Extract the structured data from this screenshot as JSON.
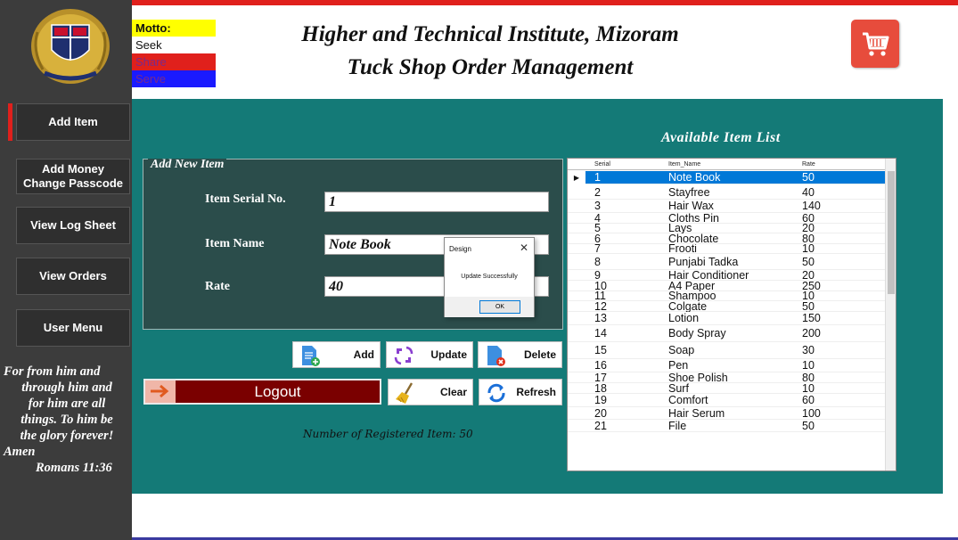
{
  "motto": {
    "heading": "Motto:",
    "words": [
      {
        "text": "Seek",
        "bg": "#ffffff",
        "fg": "#111111"
      },
      {
        "text": "Share",
        "bg": "#e0201c",
        "fg": "#7a2a8a"
      },
      {
        "text": "Serve",
        "bg": "#1a1aff",
        "fg": "#7a2a8a"
      }
    ],
    "heading_bg": "#ffff00"
  },
  "header": {
    "title": "Higher and Technical Institute, Mizoram",
    "subtitle": "Tuck Shop Order Management",
    "cart_icon": "shopping-cart-icon"
  },
  "sidebar": {
    "items": [
      {
        "label": "Add Item",
        "active": true
      },
      {
        "label": "Add Money\nChange Passcode"
      },
      {
        "label": "View Log Sheet"
      },
      {
        "label": "View Orders"
      },
      {
        "label": "User Menu"
      }
    ],
    "quote": [
      "For from him and",
      "through him and",
      "for him are all",
      "things. To him be",
      "the glory forever!",
      "Amen"
    ],
    "quote_ref": "Romans 11:36"
  },
  "form": {
    "group_title": "Add New Item",
    "serial_label": "Item Serial No.",
    "serial_value": "1",
    "name_label": "Item Name",
    "name_value": "Note Book",
    "rate_label": "Rate",
    "rate_value": "40"
  },
  "actions": {
    "add": "Add",
    "update": "Update",
    "delete": "Delete",
    "clear": "Clear",
    "refresh": "Refresh",
    "logout": "Logout"
  },
  "registered_count": "Number of Registered Item: 50",
  "item_list": {
    "title": "Available Item List",
    "columns": [
      "Serial",
      "Item_Name",
      "Rate"
    ],
    "rows": [
      [
        "1",
        "Note Book",
        "50"
      ],
      [
        "2",
        "Stayfree",
        "40"
      ],
      [
        "3",
        "Hair Wax",
        "140"
      ],
      [
        "4",
        "Cloths Pin",
        "60"
      ],
      [
        "5",
        "Lays",
        "20"
      ],
      [
        "6",
        "Chocolate",
        "80"
      ],
      [
        "7",
        "Frooti",
        "10"
      ],
      [
        "8",
        "Punjabi Tadka",
        "50"
      ],
      [
        "9",
        "Hair Conditioner",
        "20"
      ],
      [
        "10",
        "A4 Paper",
        "250"
      ],
      [
        "11",
        "Shampoo",
        "10"
      ],
      [
        "12",
        "Colgate",
        "50"
      ],
      [
        "13",
        "Lotion",
        "150"
      ],
      [
        "14",
        "Body Spray",
        "200"
      ],
      [
        "15",
        "Soap",
        "30"
      ],
      [
        "16",
        "Pen",
        "10"
      ],
      [
        "17",
        "Shoe Polish",
        "80"
      ],
      [
        "18",
        "Surf",
        "10"
      ],
      [
        "19",
        "Comfort",
        "60"
      ],
      [
        "20",
        "Hair Serum",
        "100"
      ],
      [
        "21",
        "File",
        "50"
      ]
    ],
    "selected_row": 0
  },
  "dialog": {
    "title": "Design",
    "message": "Update Successfully",
    "ok": "OK"
  },
  "colors": {
    "accent_red": "#e0201c",
    "panel_teal": "#147a77",
    "logout_bg": "#7a0000",
    "cart_bg": "#e74c3c",
    "selection": "#0078d7"
  }
}
